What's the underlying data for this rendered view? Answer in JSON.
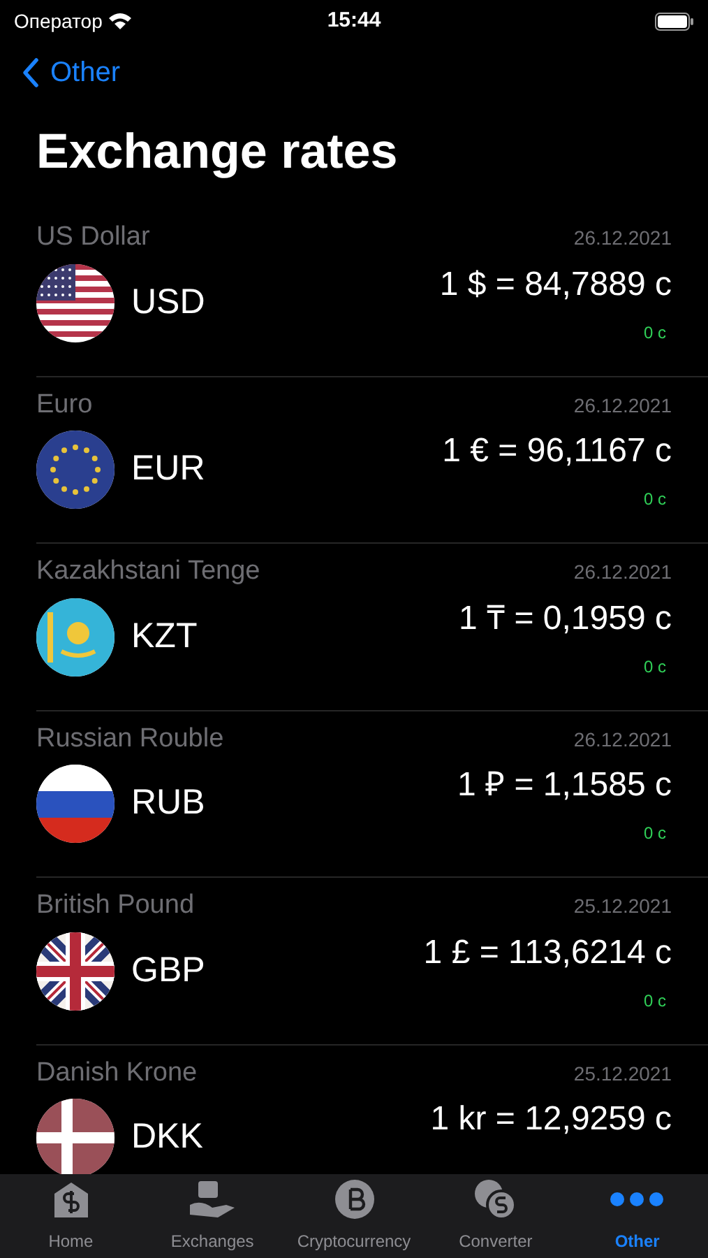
{
  "status_bar": {
    "carrier": "Оператор",
    "time": "15:44"
  },
  "nav": {
    "back": "Other"
  },
  "title": "Exchange rates",
  "rates": [
    {
      "name": "US Dollar",
      "date": "26.12.2021",
      "kind": "us",
      "code": "USD",
      "rate": "1 $ = 84,7889 с",
      "change": "0 с"
    },
    {
      "name": "Euro",
      "date": "26.12.2021",
      "kind": "eu",
      "code": "EUR",
      "rate": "1 € = 96,1167 с",
      "change": "0 с"
    },
    {
      "name": "Kazakhstani Tenge",
      "date": "26.12.2021",
      "kind": "kz",
      "code": "KZT",
      "rate": "1 ₸ = 0,1959 с",
      "change": "0 с"
    },
    {
      "name": "Russian Rouble",
      "date": "26.12.2021",
      "kind": "ru",
      "code": "RUB",
      "rate": "1 ₽ = 1,1585 с",
      "change": "0 с"
    },
    {
      "name": "British Pound",
      "date": "25.12.2021",
      "kind": "gb",
      "code": "GBP",
      "rate": "1 £ = 113,6214 с",
      "change": "0 с"
    },
    {
      "name": "Danish Krone",
      "date": "25.12.2021",
      "kind": "dk",
      "code": "DKK",
      "rate": "1 kr = 12,9259 с"
    }
  ],
  "tabs": [
    {
      "label": "Home",
      "kind": "home",
      "selected": false
    },
    {
      "label": "Exchanges",
      "kind": "exchange",
      "selected": false
    },
    {
      "label": "Cryptocurrency",
      "kind": "crypto",
      "selected": false
    },
    {
      "label": "Converter",
      "kind": "converter",
      "selected": false
    },
    {
      "label": "Other",
      "kind": "more",
      "selected": true
    }
  ]
}
